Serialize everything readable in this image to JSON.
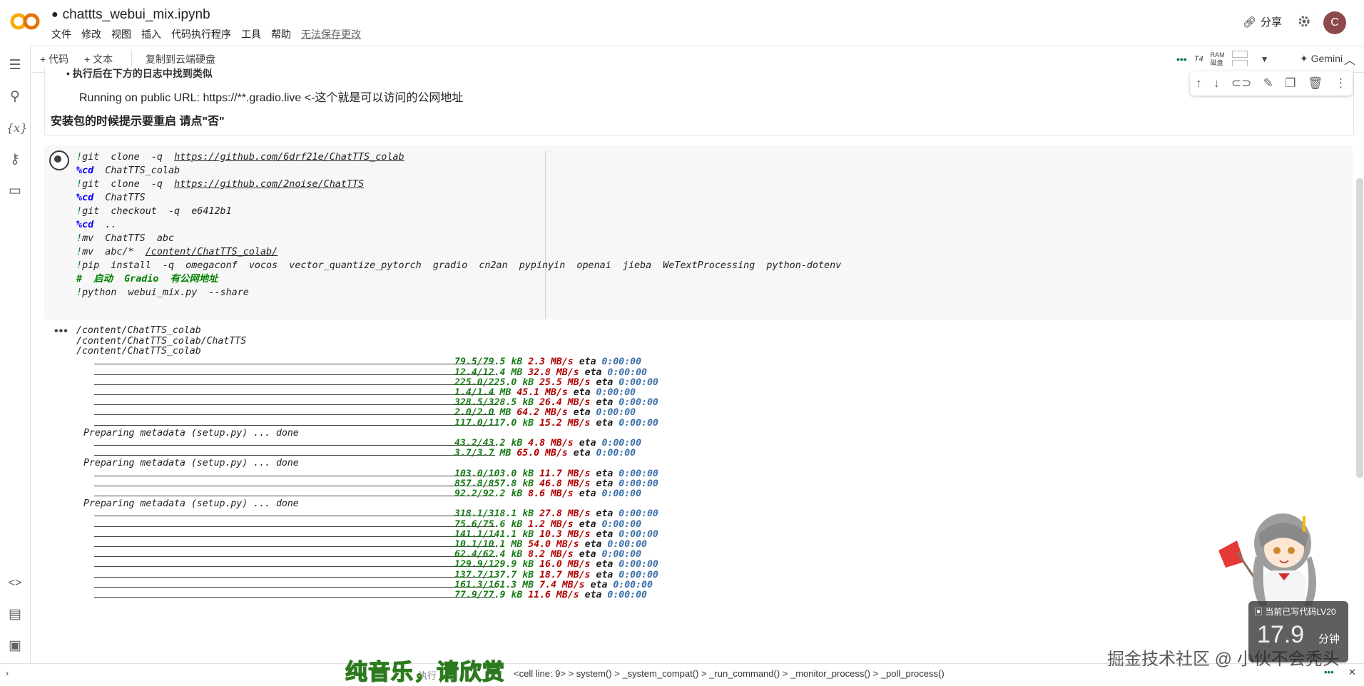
{
  "header": {
    "title": "chattts_webui_mix.ipynb",
    "menu": [
      "文件",
      "修改",
      "视图",
      "插入",
      "代码执行程序",
      "工具",
      "帮助"
    ],
    "unsaved": "无法保存更改",
    "share": "分享",
    "avatar_letter": "C"
  },
  "toolbar": {
    "add_code": "+ 代码",
    "add_text": "+ 文本",
    "copy_drive": "复制到云端硬盘",
    "runtime": "T4",
    "ram_label": "RAM",
    "disk_label": "磁盘",
    "gemini": "Gemini"
  },
  "text_cell": {
    "line1": "• 执行后在下方的日志中找到类似",
    "line2": "Running on public URL: https://**.gradio.live <-这个就是可以访问的公网地址",
    "line3": "安装包的时候提示要重启 请点\"否\""
  },
  "code_cell": {
    "lines": [
      {
        "bang": "!",
        "text": "git  clone  -q  ",
        "url": "https://github.com/6drf21e/ChatTTS_colab"
      },
      {
        "magic": "%cd",
        "text": "  ChatTTS_colab"
      },
      {
        "bang": "!",
        "text": "git  clone  -q  ",
        "url": "https://github.com/2noise/ChatTTS"
      },
      {
        "magic": "%cd",
        "text": "  ChatTTS"
      },
      {
        "bang": "!",
        "text": "git  checkout  -q  e6412b1"
      },
      {
        "magic": "%cd",
        "text": "  .."
      },
      {
        "bang": "!",
        "text": "mv  ChatTTS  abc"
      },
      {
        "bang": "!",
        "text": "mv  abc/*  ",
        "url": "/content/ChatTTS_colab/"
      },
      {
        "bang": "!",
        "text": "pip  install  -q  omegaconf  vocos  vector_quantize_pytorch  gradio  cn2an  pypinyin  openai  jieba  WeTextProcessing  python-dotenv"
      },
      {
        "comment": "#  启动  Gradio  有公网地址"
      },
      {
        "bang": "!",
        "text": "python  webui_mix.py  --share"
      }
    ]
  },
  "output": {
    "paths": [
      "/content/ChatTTS_colab",
      "/content/ChatTTS_colab/ChatTTS",
      "/content/ChatTTS_colab"
    ],
    "rows": [
      {
        "type": "bar",
        "size": "79.5/79.5 kB",
        "speed": "2.3 MB/s",
        "eta": "0:00:00"
      },
      {
        "type": "bar",
        "size": "12.4/12.4 MB",
        "speed": "32.8 MB/s",
        "eta": "0:00:00"
      },
      {
        "type": "bar",
        "size": "225.0/225.0 kB",
        "speed": "25.5 MB/s",
        "eta": "0:00:00"
      },
      {
        "type": "bar",
        "size": "1.4/1.4 MB",
        "speed": "45.1 MB/s",
        "eta": "0:00:00"
      },
      {
        "type": "bar",
        "size": "328.5/328.5 kB",
        "speed": "26.4 MB/s",
        "eta": "0:00:00"
      },
      {
        "type": "bar",
        "size": "2.0/2.0 MB",
        "speed": "64.2 MB/s",
        "eta": "0:00:00"
      },
      {
        "type": "bar",
        "size": "117.0/117.0 kB",
        "speed": "15.2 MB/s",
        "eta": "0:00:00"
      },
      {
        "type": "text",
        "text": "Preparing metadata (setup.py) ... done"
      },
      {
        "type": "bar",
        "size": "43.2/43.2 kB",
        "speed": "4.8 MB/s",
        "eta": "0:00:00"
      },
      {
        "type": "bar",
        "size": "3.7/3.7 MB",
        "speed": "65.0 MB/s",
        "eta": "0:00:00"
      },
      {
        "type": "text",
        "text": "Preparing metadata (setup.py) ... done"
      },
      {
        "type": "bar",
        "size": "103.0/103.0 kB",
        "speed": "11.7 MB/s",
        "eta": "0:00:00"
      },
      {
        "type": "bar",
        "size": "857.8/857.8 kB",
        "speed": "46.8 MB/s",
        "eta": "0:00:00"
      },
      {
        "type": "bar",
        "size": "92.2/92.2 kB",
        "speed": "8.6 MB/s",
        "eta": "0:00:00"
      },
      {
        "type": "text",
        "text": "Preparing metadata (setup.py) ... done"
      },
      {
        "type": "bar",
        "size": "318.1/318.1 kB",
        "speed": "27.8 MB/s",
        "eta": "0:00:00"
      },
      {
        "type": "bar",
        "size": "75.6/75.6 kB",
        "speed": "1.2 MB/s",
        "eta": "0:00:00"
      },
      {
        "type": "bar",
        "size": "141.1/141.1 kB",
        "speed": "10.3 MB/s",
        "eta": "0:00:00"
      },
      {
        "type": "bar",
        "size": "10.1/10.1 MB",
        "speed": "54.0 MB/s",
        "eta": "0:00:00"
      },
      {
        "type": "bar",
        "size": "62.4/62.4 kB",
        "speed": "8.2 MB/s",
        "eta": "0:00:00"
      },
      {
        "type": "bar",
        "size": "129.9/129.9 kB",
        "speed": "16.0 MB/s",
        "eta": "0:00:00"
      },
      {
        "type": "bar",
        "size": "137.7/137.7 kB",
        "speed": "18.7 MB/s",
        "eta": "0:00:00"
      },
      {
        "type": "bar",
        "size": "161.3/161.3 MB",
        "speed": "7.4 MB/s",
        "eta": "0:00:00"
      },
      {
        "type": "bar",
        "size": "77.9/77.9 kB",
        "speed": "11.6 MB/s",
        "eta": "0:00:00"
      }
    ]
  },
  "statusbar": {
    "running": "执行",
    "trace": "<cell line: 9> > system() > _system_compat() > _run_command() > _monitor_process() > _poll_process()"
  },
  "overlay": {
    "subtitle": "纯音乐，请欣赏",
    "watermark": "掘金技术社区 @ 小伙不会秃头",
    "badge_title": "当前已写代码LV20",
    "badge_value": "17.9",
    "badge_unit": "分钟"
  }
}
